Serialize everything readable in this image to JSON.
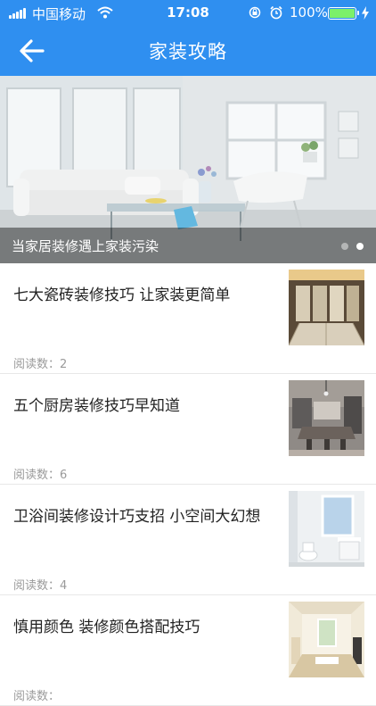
{
  "status_bar": {
    "carrier": "中国移动",
    "time": "17:08",
    "battery": "100%"
  },
  "nav": {
    "title": "家装攻略"
  },
  "banner": {
    "caption": "当家居装修遇上家装污染",
    "page_count": 2,
    "active_page": 2
  },
  "articles": [
    {
      "title": "七大瓷砖装修技巧 让家装更简单",
      "read_label": "阅读数：",
      "read_count": "2"
    },
    {
      "title": "五个厨房装修技巧早知道",
      "read_label": "阅读数：",
      "read_count": "6"
    },
    {
      "title": "卫浴间装修设计巧支招 小空间大幻想",
      "read_label": "阅读数：",
      "read_count": "4"
    },
    {
      "title": "慎用颜色 装修颜色搭配技巧",
      "read_label": "阅读数：",
      "read_count": ""
    }
  ],
  "colors": {
    "header_bg": "#2f8ff0",
    "battery_fill": "#7cf06a",
    "meta_text": "#9a9a9a"
  }
}
